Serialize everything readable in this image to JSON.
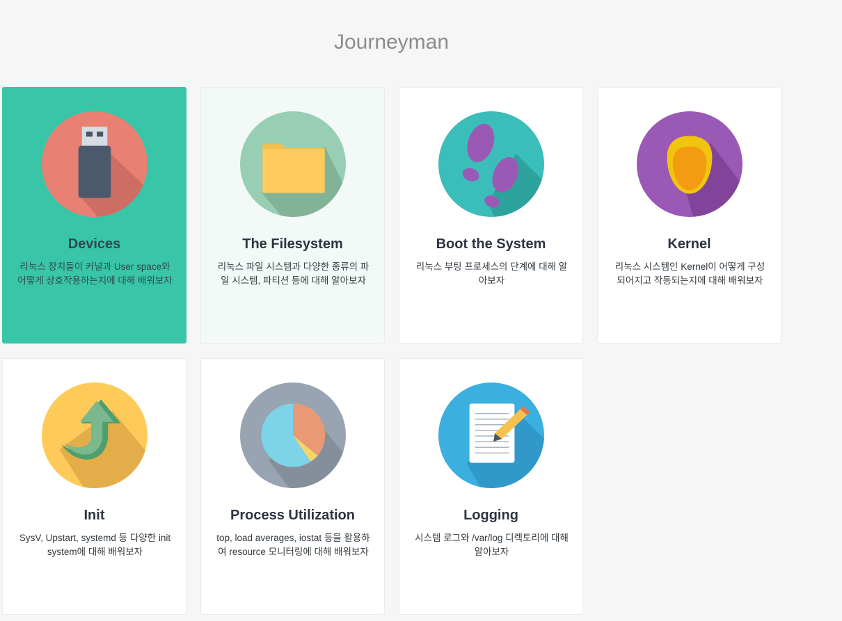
{
  "page": {
    "title": "Journeyman"
  },
  "cards": [
    {
      "title": "Devices",
      "description": "리눅스 장치들이 커널과 User space와 어떻게 상호작용하는지에 대해 배워보자",
      "icon": "usb-drive-icon",
      "state": "active"
    },
    {
      "title": "The Filesystem",
      "description": "리눅스 파일 시스템과 다양한 종류의 파일 시스템, 파티션 등에 대해 알아보자",
      "icon": "folder-icon",
      "state": "hover"
    },
    {
      "title": "Boot the System",
      "description": "리눅스 부팅 프로세스의 단계에 대해 알아보자",
      "icon": "footprints-icon",
      "state": "normal"
    },
    {
      "title": "Kernel",
      "description": "리눅스 시스템인 Kernel이 어떻게 구성되어지고 작동되는지에 대해 배워보자",
      "icon": "kernel-seed-icon",
      "state": "normal"
    },
    {
      "title": "Init",
      "description": "SysV, Upstart, systemd 등 다양한 init system에 대해 배워보자",
      "icon": "curved-arrow-icon",
      "state": "normal"
    },
    {
      "title": "Process Utilization",
      "description": "top, load averages, iostat 등을 활용하여 resource 모니터링에 대해 배워보자",
      "icon": "pie-chart-icon",
      "state": "normal"
    },
    {
      "title": "Logging",
      "description": "시스템 로그와 /var/log 디렉토리에 대해 알아보자",
      "icon": "document-pencil-icon",
      "state": "normal"
    }
  ],
  "colors": {
    "active_card": "#39c5a7",
    "hover_card": "#f2f9f7",
    "background": "#f6f6f6"
  }
}
